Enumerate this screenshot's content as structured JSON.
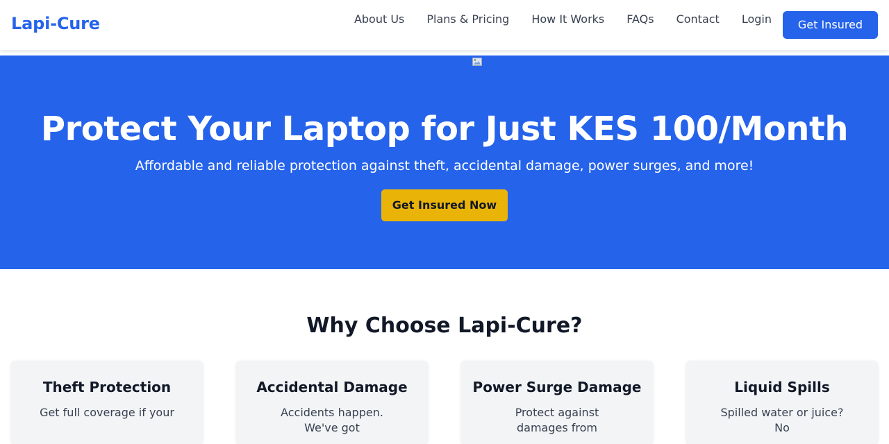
{
  "brand": {
    "name": "Lapi-Cure",
    "accent": "#2563eb",
    "highlight": "#eab308"
  },
  "nav": {
    "items": [
      {
        "label": "About Us"
      },
      {
        "label": "Plans & Pricing"
      },
      {
        "label": "How It Works"
      },
      {
        "label": "FAQs"
      },
      {
        "label": "Contact"
      },
      {
        "label": "Login"
      }
    ],
    "cta_label": "Get Insured"
  },
  "hero": {
    "image_icon": "broken-image-icon",
    "title": "Protect Your Laptop for Just KES 100/Month",
    "subtitle": "Affordable and reliable protection against theft, accidental damage, power surges, and more!",
    "cta_label": "Get Insured Now"
  },
  "features": {
    "title": "Why Choose Lapi-Cure?",
    "cards": [
      {
        "title": "Theft Protection",
        "text": "Get full coverage if your"
      },
      {
        "title": "Accidental Damage",
        "text": "Accidents happen. We've got"
      },
      {
        "title": "Power Surge Damage",
        "text": "Protect against damages from"
      },
      {
        "title": "Liquid Spills",
        "text": "Spilled water or juice? No"
      }
    ]
  }
}
